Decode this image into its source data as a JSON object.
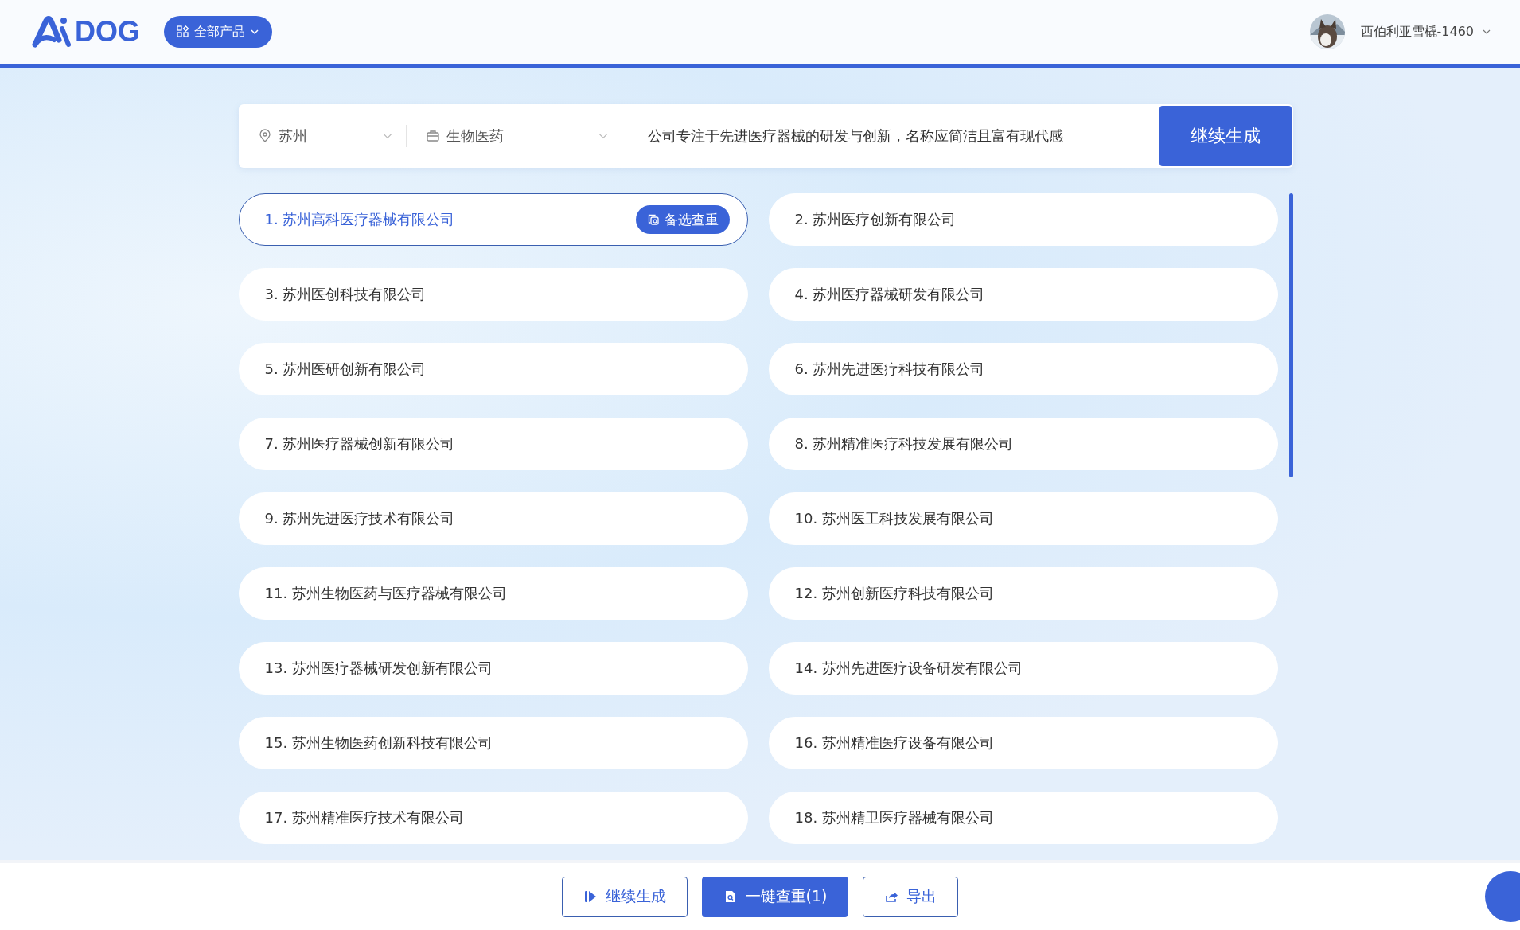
{
  "header": {
    "logo": "DOG",
    "products_button": "全部产品",
    "user": {
      "name": "西伯利亚雪橇-1460"
    }
  },
  "search": {
    "city": "苏州",
    "industry": "生物医药",
    "description": "公司专注于先进医疗器械的研发与创新，名称应简洁且富有现代感",
    "submit": "继续生成"
  },
  "results": {
    "check_button": "备选查重",
    "items": [
      {
        "label": "1. 苏州高科医疗器械有限公司",
        "selected": true
      },
      {
        "label": "2. 苏州医疗创新有限公司",
        "selected": false
      },
      {
        "label": "3. 苏州医创科技有限公司",
        "selected": false
      },
      {
        "label": "4. 苏州医疗器械研发有限公司",
        "selected": false
      },
      {
        "label": "5. 苏州医研创新有限公司",
        "selected": false
      },
      {
        "label": "6. 苏州先进医疗科技有限公司",
        "selected": false
      },
      {
        "label": "7. 苏州医疗器械创新有限公司",
        "selected": false
      },
      {
        "label": "8. 苏州精准医疗科技发展有限公司",
        "selected": false
      },
      {
        "label": "9. 苏州先进医疗技术有限公司",
        "selected": false
      },
      {
        "label": "10. 苏州医工科技发展有限公司",
        "selected": false
      },
      {
        "label": "11. 苏州生物医药与医疗器械有限公司",
        "selected": false
      },
      {
        "label": "12. 苏州创新医疗科技有限公司",
        "selected": false
      },
      {
        "label": "13. 苏州医疗器械研发创新有限公司",
        "selected": false
      },
      {
        "label": "14. 苏州先进医疗设备研发有限公司",
        "selected": false
      },
      {
        "label": "15. 苏州生物医药创新科技有限公司",
        "selected": false
      },
      {
        "label": "16. 苏州精准医疗设备有限公司",
        "selected": false
      },
      {
        "label": "17. 苏州精准医疗技术有限公司",
        "selected": false
      },
      {
        "label": "18. 苏州精卫医疗器械有限公司",
        "selected": false
      }
    ]
  },
  "footer": {
    "buttons": [
      {
        "label": "继续生成",
        "kind": "continue"
      },
      {
        "label": "一键查重(1)",
        "kind": "check"
      },
      {
        "label": "导出",
        "kind": "export"
      }
    ]
  }
}
